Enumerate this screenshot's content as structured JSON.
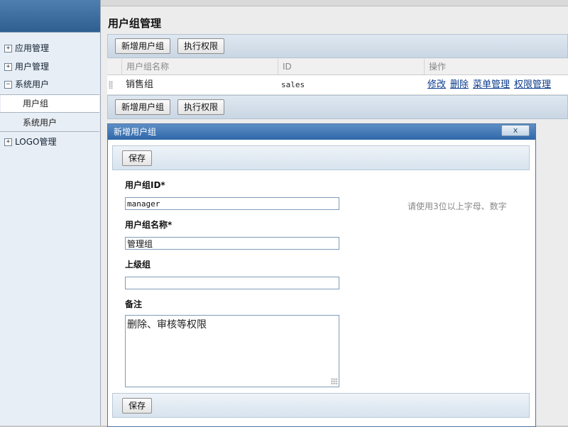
{
  "sidebar": {
    "items": [
      {
        "label": "应用管理",
        "toggle": "+"
      },
      {
        "label": "用户管理",
        "toggle": "+"
      },
      {
        "label": "系统用户",
        "toggle": "−"
      },
      {
        "label": "LOGO管理",
        "toggle": "+"
      }
    ],
    "sub_items": [
      {
        "label": "用户组",
        "active": true
      },
      {
        "label": "系统用户",
        "active": false
      }
    ]
  },
  "page": {
    "title": "用户组管理",
    "toolbar": {
      "add_label": "新增用户组",
      "exec_label": "执行权限"
    }
  },
  "grid": {
    "columns": [
      "用户组名称",
      "ID",
      "操作"
    ],
    "rows": [
      {
        "name": "销售组",
        "id": "sales",
        "actions": [
          "修改",
          "删除",
          "菜单管理",
          "权限管理"
        ]
      }
    ]
  },
  "dialog": {
    "title": "新增用户组",
    "close_label": "x",
    "save_label": "保存",
    "fields": {
      "group_id": {
        "label": "用户组ID*",
        "value": "manager"
      },
      "group_name": {
        "label": "用户组名称*",
        "value": "管理组"
      },
      "parent": {
        "label": "上级组",
        "value": ""
      },
      "remark": {
        "label": "备注",
        "value": "删除、审核等权限"
      }
    },
    "hint": "请使用3位以上字母、数字"
  },
  "colors": {
    "accent": "#2f67a8",
    "link": "#0b3c8c"
  }
}
